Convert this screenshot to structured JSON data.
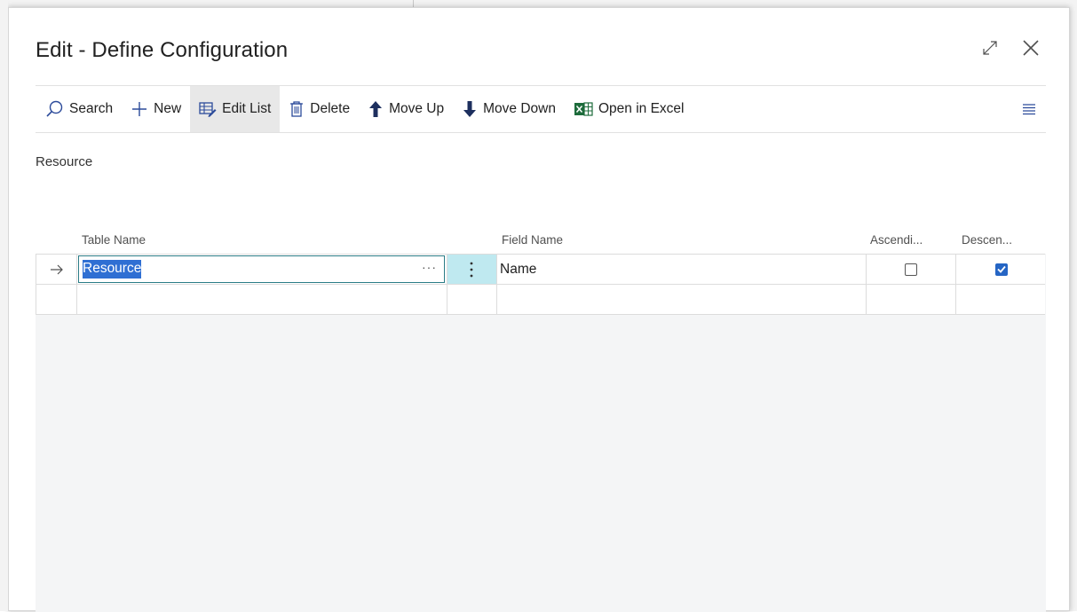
{
  "dialog": {
    "title": "Edit - Define Configuration"
  },
  "toolbar": {
    "search_label": "Search",
    "new_label": "New",
    "edit_list_label": "Edit List",
    "delete_label": "Delete",
    "move_up_label": "Move Up",
    "move_down_label": "Move Down",
    "open_in_excel_label": "Open in Excel"
  },
  "page": {
    "subtitle": "Resource"
  },
  "grid": {
    "columns": {
      "table_name": "Table Name",
      "field_name": "Field Name",
      "ascending": "Ascendi...",
      "descending": "Descen..."
    },
    "rows": [
      {
        "table_name": "Resource",
        "field_name": "Name",
        "ascending": false,
        "descending": true
      },
      {
        "table_name": "",
        "field_name": "",
        "ascending": null,
        "descending": null
      }
    ],
    "lookup_glyph": "···"
  },
  "colors": {
    "accent_teal": "#2b7c86",
    "selection_blue": "#2f6fd3",
    "checkbox_blue": "#2565c4",
    "active_menu_cell": "#bfe9f0"
  }
}
